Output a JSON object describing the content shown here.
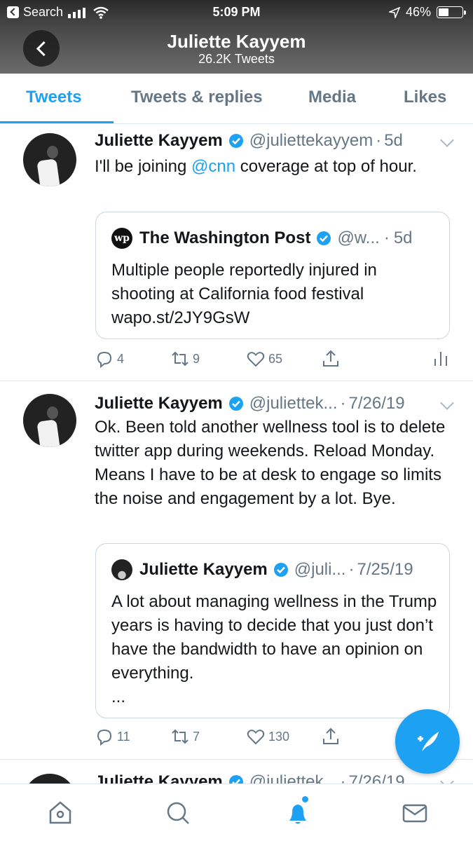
{
  "status": {
    "carrier": "Search",
    "time": "5:09 PM",
    "battery": "46%"
  },
  "profile": {
    "name": "Juliette Kayyem",
    "tweet_count": "26.2K Tweets"
  },
  "tabs": [
    {
      "label": "Tweets",
      "active": true
    },
    {
      "label": "Tweets & replies"
    },
    {
      "label": "Media"
    },
    {
      "label": "Likes"
    }
  ],
  "tweets": [
    {
      "name": "Juliette Kayyem",
      "handle": "@juliettekayyem",
      "time": "5d",
      "text_before": "I'll be joining ",
      "mention": "@cnn",
      "text_after": " coverage at top of hour.",
      "quote": {
        "logo": "wp",
        "name": "The Washington Post",
        "handle": "@w...",
        "time": "5d",
        "text": "Multiple people reportedly injured in shooting at California food festival wapo.st/2JY9GsW"
      },
      "actions": {
        "replies": "4",
        "retweets": "9",
        "likes": "65"
      }
    },
    {
      "name": "Juliette Kayyem",
      "handle": "@juliettek...",
      "time": "7/26/19",
      "text": "Ok. Been told another wellness tool is to delete twitter app during weekends. Reload Monday. Means I have to be at desk to engage so limits the noise and engagement by a lot. Bye.",
      "quote": {
        "name": "Juliette Kayyem",
        "handle": "@juli...",
        "time": "7/25/19",
        "text": "A lot about managing wellness in the Trump years is having to decide that you just don’t have the bandwidth to have an opinion on everything.",
        "ellipsis": "..."
      },
      "actions": {
        "replies": "11",
        "retweets": "7",
        "likes": "130"
      }
    },
    {
      "name": "Juliette Kayyem",
      "handle": "@juliettek...",
      "time": "7/26/19"
    }
  ],
  "separator": "·",
  "colors": {
    "accent": "#1da1f2",
    "muted": "#657786",
    "verified": "#1da1f2"
  },
  "icons": [
    "back-icon",
    "verified-icon",
    "reply-icon",
    "retweet-icon",
    "like-icon",
    "share-icon",
    "analytics-icon",
    "compose-icon",
    "home-icon",
    "search-icon",
    "notifications-icon",
    "messages-icon"
  ]
}
